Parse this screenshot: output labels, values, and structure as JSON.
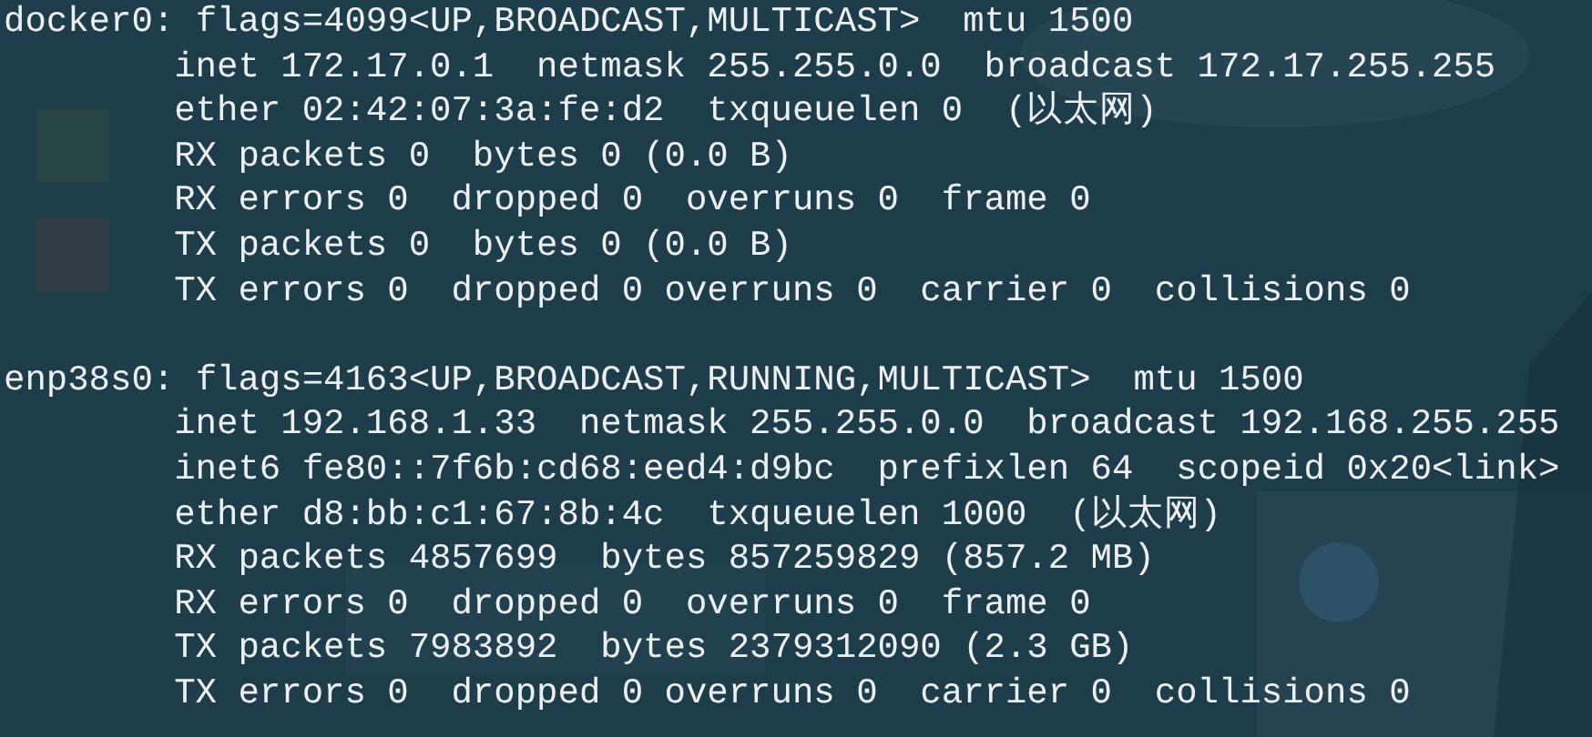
{
  "terminal": {
    "interfaces": [
      {
        "header": "docker0: flags=4099<UP,BROADCAST,MULTICAST>  mtu 1500",
        "details": [
          "inet 172.17.0.1  netmask 255.255.0.0  broadcast 172.17.255.255",
          "ether 02:42:07:3a:fe:d2  txqueuelen 0  (以太网)",
          "RX packets 0  bytes 0 (0.0 B)",
          "RX errors 0  dropped 0  overruns 0  frame 0",
          "TX packets 0  bytes 0 (0.0 B)",
          "TX errors 0  dropped 0 overruns 0  carrier 0  collisions 0"
        ]
      },
      {
        "header": "enp38s0: flags=4163<UP,BROADCAST,RUNNING,MULTICAST>  mtu 1500",
        "details": [
          "inet 192.168.1.33  netmask 255.255.0.0  broadcast 192.168.255.255",
          "inet6 fe80::7f6b:cd68:eed4:d9bc  prefixlen 64  scopeid 0x20<link>",
          "ether d8:bb:c1:67:8b:4c  txqueuelen 1000  (以太网)",
          "RX packets 4857699  bytes 857259829 (857.2 MB)",
          "RX errors 0  dropped 0  overruns 0  frame 0",
          "TX packets 7983892  bytes 2379312090 (2.3 GB)",
          "TX errors 0  dropped 0 overruns 0  carrier 0  collisions 0"
        ]
      }
    ]
  }
}
